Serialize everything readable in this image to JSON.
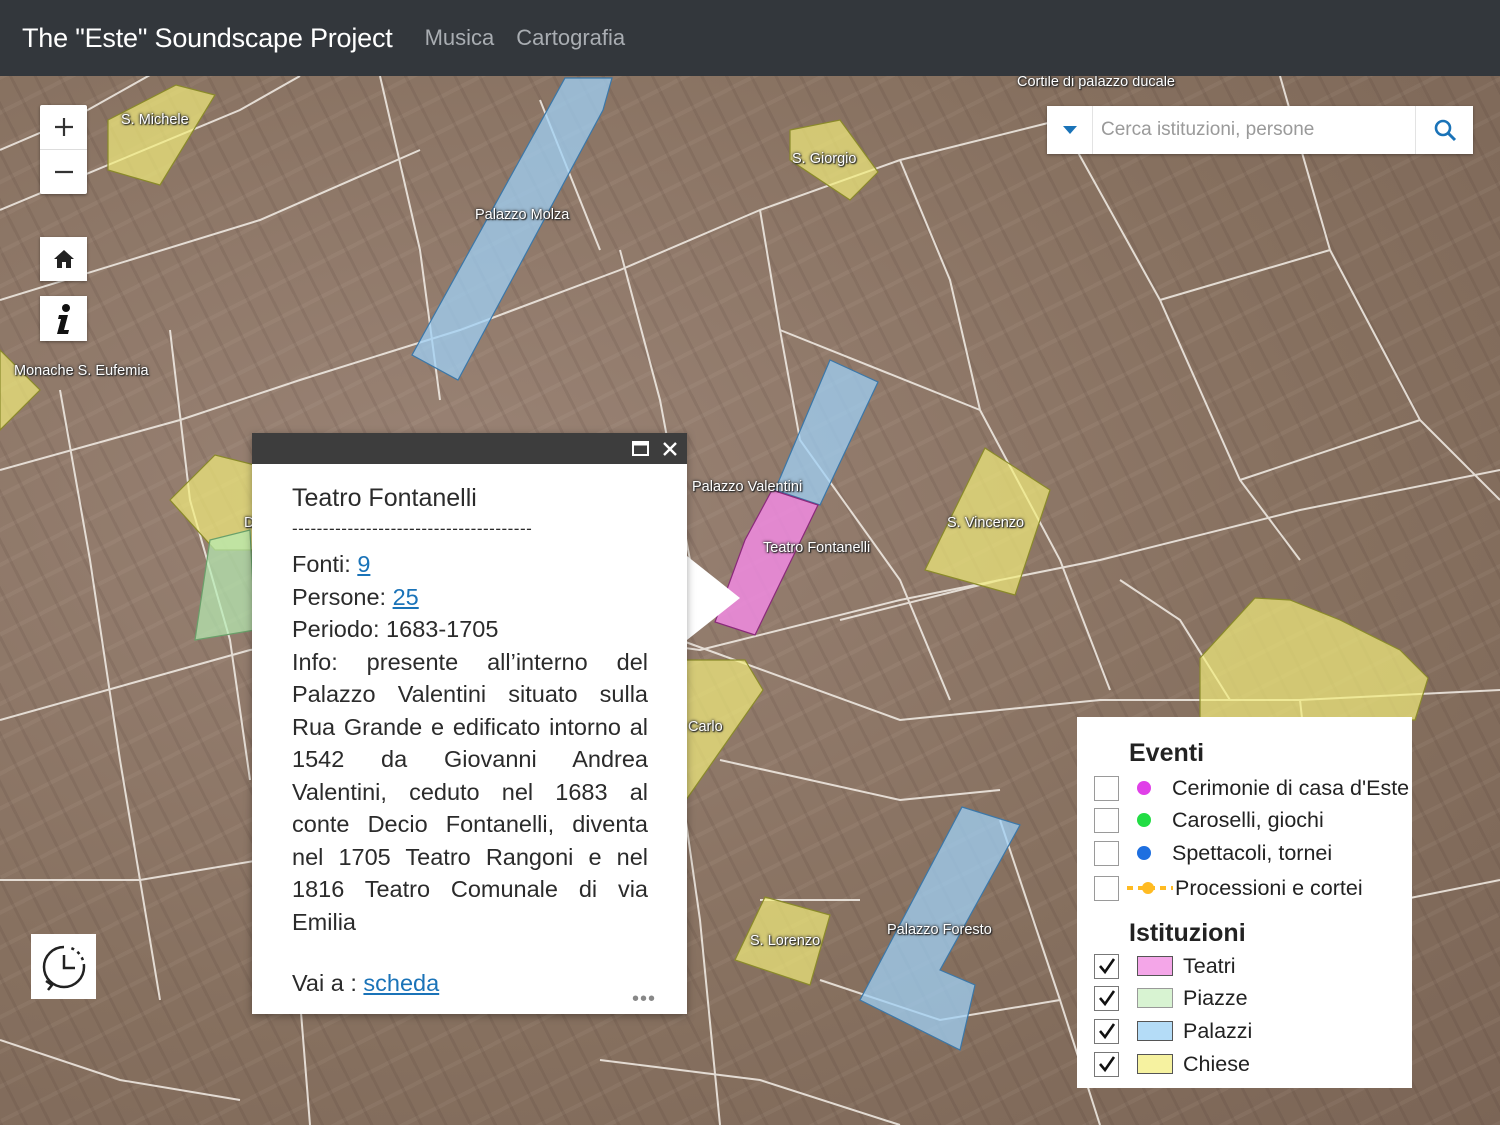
{
  "header": {
    "brand": "The \"Este\" Soundscape Project",
    "nav": [
      "Musica",
      "Cartografia"
    ]
  },
  "search": {
    "placeholder": "Cerca istituzioni, persone"
  },
  "map_labels": [
    "S. Michele",
    "S. Giorgio",
    "Palazzo Molza",
    "Monache S. Eufemia",
    "Palazzo Valentini",
    "Teatro Fontanelli",
    "S. Vincenzo",
    "Carlo",
    "S. Lorenzo",
    "Palazzo Foresto",
    "Cortile di palazzo ducale",
    "D"
  ],
  "popup": {
    "title": "Teatro Fontanelli",
    "separator": "---------------------------------------",
    "fonti_label": "Fonti: ",
    "fonti_value": "9",
    "persone_label": "Persone: ",
    "persone_value": "25",
    "periodo": "Periodo: 1683-1705",
    "info": "Info: presente all’interno del Palazzo Valentini situato sulla Rua Grande e edificato intorno al 1542 da Giovanni Andrea Valentini, ceduto nel 1683 al conte Decio Fontanelli, diventa nel 1705 Teatro Rangoni e nel 1816 Teatro Comunale di via Emilia",
    "vai_label": "Vai a : ",
    "vai_link": "scheda",
    "more": "•••"
  },
  "legend": {
    "eventi_title": "Eventi",
    "eventi": [
      {
        "label": "Cerimonie di casa d'Este",
        "color": "#e040e8",
        "checked": false
      },
      {
        "label": "Caroselli, giochi",
        "color": "#22dd44",
        "checked": false
      },
      {
        "label": "Spettacoli, tornei",
        "color": "#1e6fe0",
        "checked": false
      },
      {
        "label": "Processioni e cortei",
        "color": "#ffbb22",
        "checked": false
      }
    ],
    "istituzioni_title": "Istituzioni",
    "istituzioni": [
      {
        "label": "Teatri",
        "color": "#f4a6e8",
        "checked": true
      },
      {
        "label": "Piazze",
        "color": "#d8f3d2",
        "checked": true
      },
      {
        "label": "Palazzi",
        "color": "#b4dcf7",
        "checked": true
      },
      {
        "label": "Chiese",
        "color": "#f6f2a0",
        "checked": true
      }
    ]
  },
  "colors": {
    "topbar": "#33373c",
    "link": "#1a73b8",
    "teatri": "#f08be0",
    "piazze": "#b7ecb4",
    "palazzi": "#9fd0f5",
    "chiese": "#f2ec7c"
  }
}
